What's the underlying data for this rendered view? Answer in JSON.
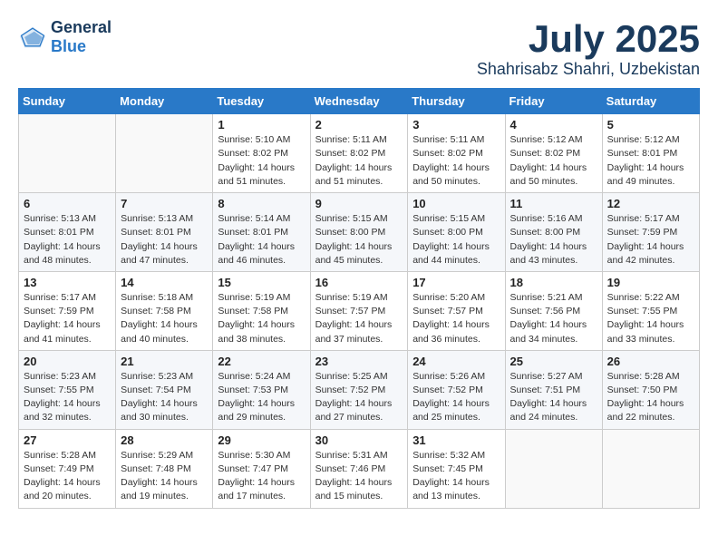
{
  "logo": {
    "line1": "General",
    "line2": "Blue"
  },
  "title": {
    "month": "July 2025",
    "location": "Shahrisabz Shahri, Uzbekistan"
  },
  "headers": [
    "Sunday",
    "Monday",
    "Tuesday",
    "Wednesday",
    "Thursday",
    "Friday",
    "Saturday"
  ],
  "weeks": [
    [
      {
        "day": "",
        "info": ""
      },
      {
        "day": "",
        "info": ""
      },
      {
        "day": "1",
        "info": "Sunrise: 5:10 AM\nSunset: 8:02 PM\nDaylight: 14 hours\nand 51 minutes."
      },
      {
        "day": "2",
        "info": "Sunrise: 5:11 AM\nSunset: 8:02 PM\nDaylight: 14 hours\nand 51 minutes."
      },
      {
        "day": "3",
        "info": "Sunrise: 5:11 AM\nSunset: 8:02 PM\nDaylight: 14 hours\nand 50 minutes."
      },
      {
        "day": "4",
        "info": "Sunrise: 5:12 AM\nSunset: 8:02 PM\nDaylight: 14 hours\nand 50 minutes."
      },
      {
        "day": "5",
        "info": "Sunrise: 5:12 AM\nSunset: 8:01 PM\nDaylight: 14 hours\nand 49 minutes."
      }
    ],
    [
      {
        "day": "6",
        "info": "Sunrise: 5:13 AM\nSunset: 8:01 PM\nDaylight: 14 hours\nand 48 minutes."
      },
      {
        "day": "7",
        "info": "Sunrise: 5:13 AM\nSunset: 8:01 PM\nDaylight: 14 hours\nand 47 minutes."
      },
      {
        "day": "8",
        "info": "Sunrise: 5:14 AM\nSunset: 8:01 PM\nDaylight: 14 hours\nand 46 minutes."
      },
      {
        "day": "9",
        "info": "Sunrise: 5:15 AM\nSunset: 8:00 PM\nDaylight: 14 hours\nand 45 minutes."
      },
      {
        "day": "10",
        "info": "Sunrise: 5:15 AM\nSunset: 8:00 PM\nDaylight: 14 hours\nand 44 minutes."
      },
      {
        "day": "11",
        "info": "Sunrise: 5:16 AM\nSunset: 8:00 PM\nDaylight: 14 hours\nand 43 minutes."
      },
      {
        "day": "12",
        "info": "Sunrise: 5:17 AM\nSunset: 7:59 PM\nDaylight: 14 hours\nand 42 minutes."
      }
    ],
    [
      {
        "day": "13",
        "info": "Sunrise: 5:17 AM\nSunset: 7:59 PM\nDaylight: 14 hours\nand 41 minutes."
      },
      {
        "day": "14",
        "info": "Sunrise: 5:18 AM\nSunset: 7:58 PM\nDaylight: 14 hours\nand 40 minutes."
      },
      {
        "day": "15",
        "info": "Sunrise: 5:19 AM\nSunset: 7:58 PM\nDaylight: 14 hours\nand 38 minutes."
      },
      {
        "day": "16",
        "info": "Sunrise: 5:19 AM\nSunset: 7:57 PM\nDaylight: 14 hours\nand 37 minutes."
      },
      {
        "day": "17",
        "info": "Sunrise: 5:20 AM\nSunset: 7:57 PM\nDaylight: 14 hours\nand 36 minutes."
      },
      {
        "day": "18",
        "info": "Sunrise: 5:21 AM\nSunset: 7:56 PM\nDaylight: 14 hours\nand 34 minutes."
      },
      {
        "day": "19",
        "info": "Sunrise: 5:22 AM\nSunset: 7:55 PM\nDaylight: 14 hours\nand 33 minutes."
      }
    ],
    [
      {
        "day": "20",
        "info": "Sunrise: 5:23 AM\nSunset: 7:55 PM\nDaylight: 14 hours\nand 32 minutes."
      },
      {
        "day": "21",
        "info": "Sunrise: 5:23 AM\nSunset: 7:54 PM\nDaylight: 14 hours\nand 30 minutes."
      },
      {
        "day": "22",
        "info": "Sunrise: 5:24 AM\nSunset: 7:53 PM\nDaylight: 14 hours\nand 29 minutes."
      },
      {
        "day": "23",
        "info": "Sunrise: 5:25 AM\nSunset: 7:52 PM\nDaylight: 14 hours\nand 27 minutes."
      },
      {
        "day": "24",
        "info": "Sunrise: 5:26 AM\nSunset: 7:52 PM\nDaylight: 14 hours\nand 25 minutes."
      },
      {
        "day": "25",
        "info": "Sunrise: 5:27 AM\nSunset: 7:51 PM\nDaylight: 14 hours\nand 24 minutes."
      },
      {
        "day": "26",
        "info": "Sunrise: 5:28 AM\nSunset: 7:50 PM\nDaylight: 14 hours\nand 22 minutes."
      }
    ],
    [
      {
        "day": "27",
        "info": "Sunrise: 5:28 AM\nSunset: 7:49 PM\nDaylight: 14 hours\nand 20 minutes."
      },
      {
        "day": "28",
        "info": "Sunrise: 5:29 AM\nSunset: 7:48 PM\nDaylight: 14 hours\nand 19 minutes."
      },
      {
        "day": "29",
        "info": "Sunrise: 5:30 AM\nSunset: 7:47 PM\nDaylight: 14 hours\nand 17 minutes."
      },
      {
        "day": "30",
        "info": "Sunrise: 5:31 AM\nSunset: 7:46 PM\nDaylight: 14 hours\nand 15 minutes."
      },
      {
        "day": "31",
        "info": "Sunrise: 5:32 AM\nSunset: 7:45 PM\nDaylight: 14 hours\nand 13 minutes."
      },
      {
        "day": "",
        "info": ""
      },
      {
        "day": "",
        "info": ""
      }
    ]
  ]
}
